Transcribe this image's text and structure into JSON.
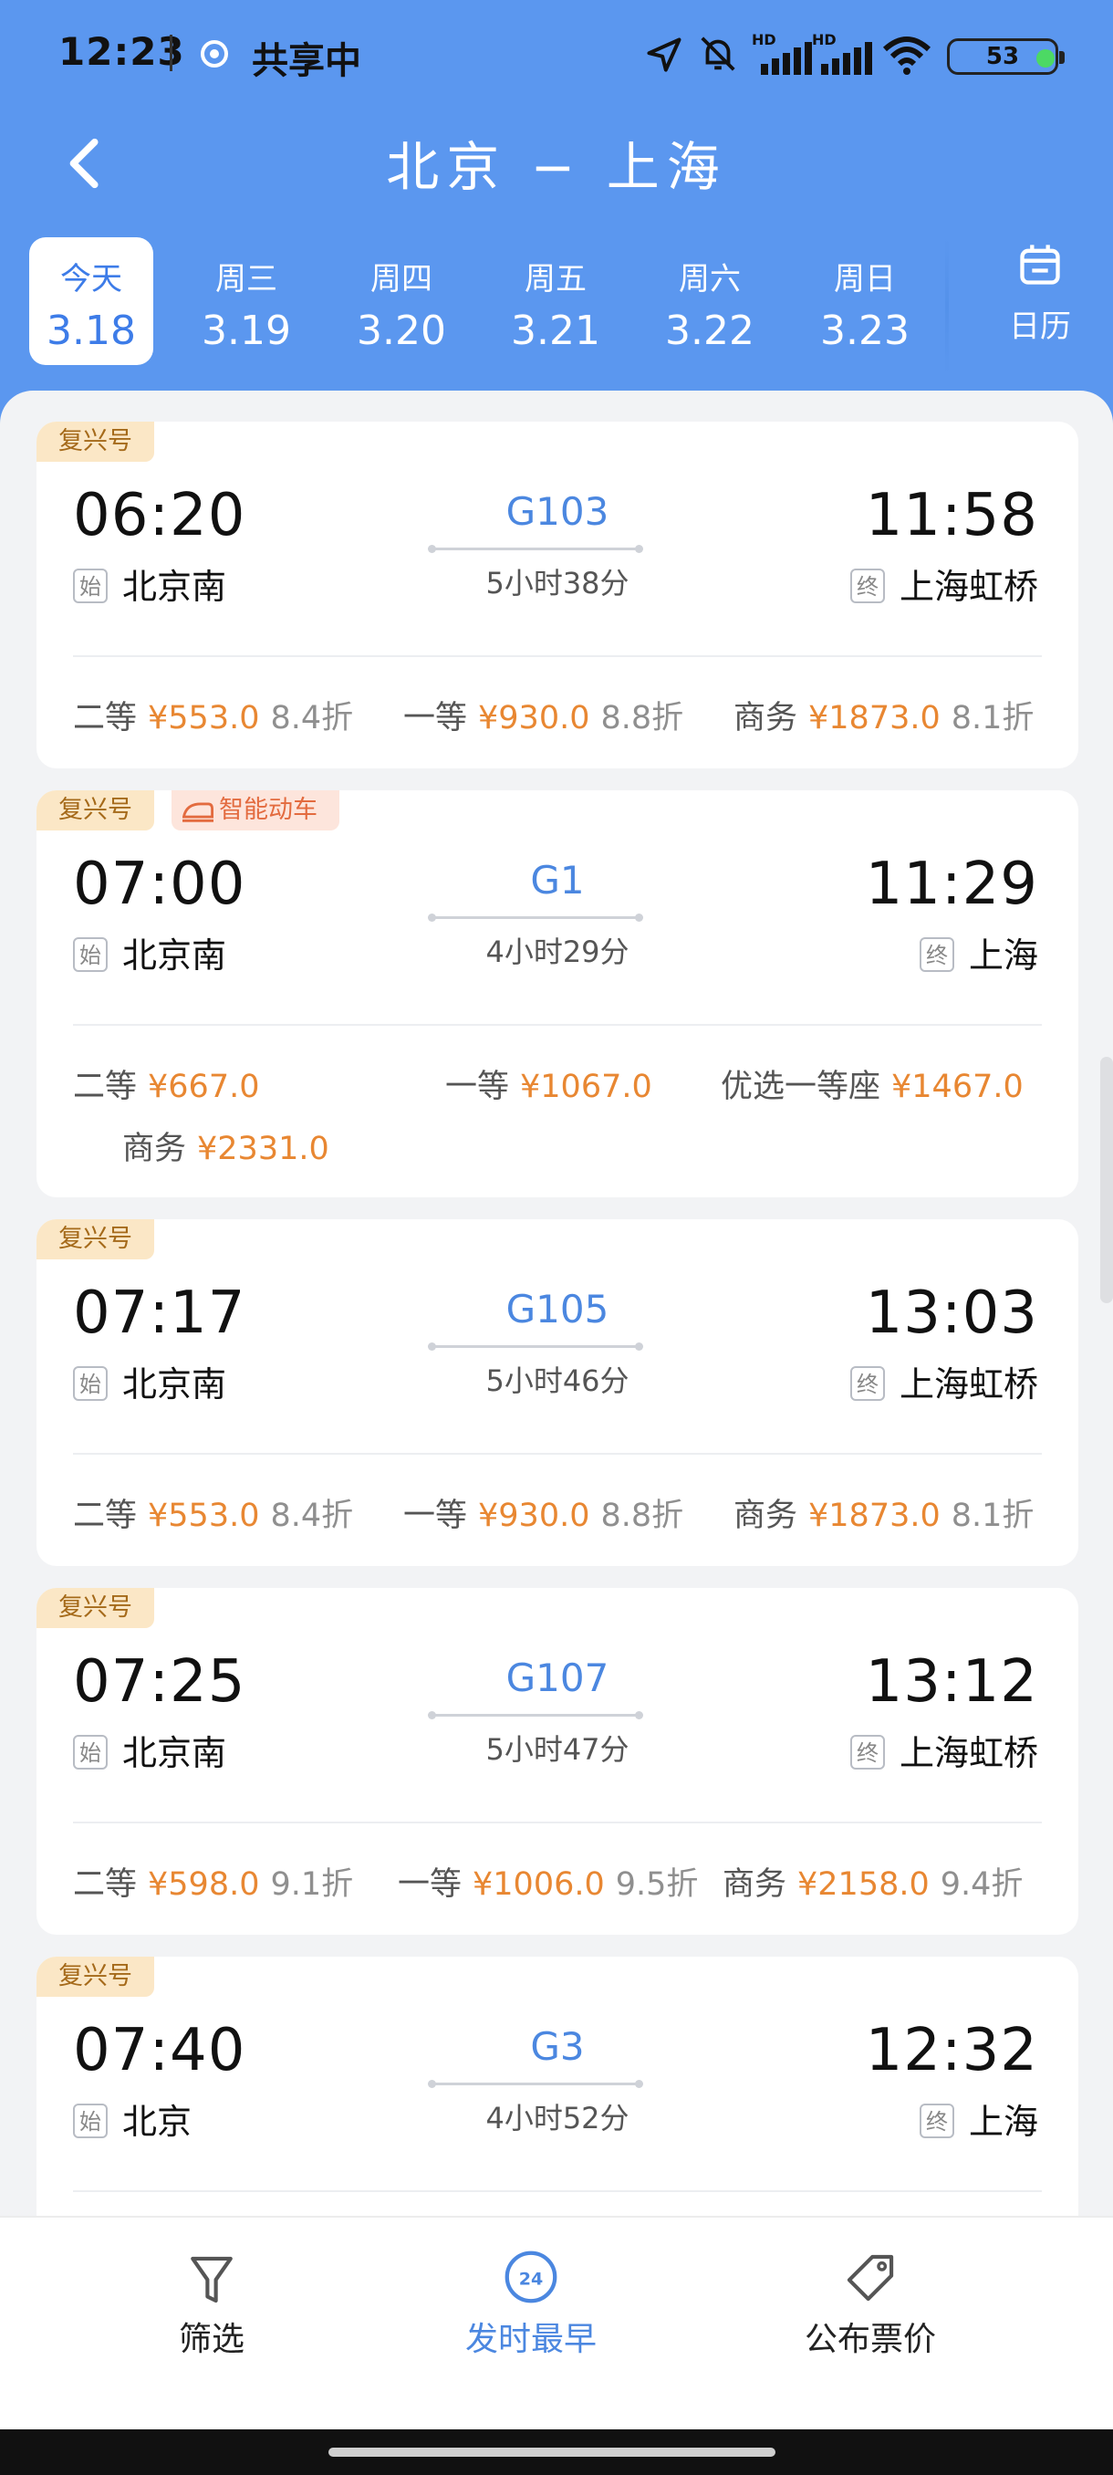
{
  "status_bar": {
    "time": "12:23",
    "sharing_label": "共享中",
    "battery": "53",
    "signal_label_1": "HD",
    "signal_label_2": "HD"
  },
  "nav": {
    "title": "北京 − 上海"
  },
  "dates": [
    {
      "dow": "今天",
      "date": "3.18",
      "active": true
    },
    {
      "dow": "周三",
      "date": "3.19"
    },
    {
      "dow": "周四",
      "date": "3.20"
    },
    {
      "dow": "周五",
      "date": "3.21"
    },
    {
      "dow": "周六",
      "date": "3.22"
    },
    {
      "dow": "周日",
      "date": "3.23"
    }
  ],
  "calendar_label": "日历",
  "badges": {
    "start": "始",
    "end": "终"
  },
  "trains": [
    {
      "tag": "复兴号",
      "dep_time": "06:20",
      "arr_time": "11:58",
      "train_no": "G103",
      "duration": "5小时38分",
      "from": "北京南",
      "to": "上海虹桥",
      "seats": [
        {
          "class": "二等",
          "price": "¥553.0",
          "disc": "8.4折"
        },
        {
          "class": "一等",
          "price": "¥930.0",
          "disc": "8.8折"
        },
        {
          "class": "商务",
          "price": "¥1873.0",
          "disc": "8.1折"
        }
      ]
    },
    {
      "tag": "复兴号",
      "tag2": "智能动车",
      "dep_time": "07:00",
      "arr_time": "11:29",
      "train_no": "G1",
      "duration": "4小时29分",
      "from": "北京南",
      "to": "上海",
      "seats": [
        {
          "class": "二等",
          "price": "¥667.0",
          "disc": ""
        },
        {
          "class": "一等",
          "price": "¥1067.0",
          "disc": ""
        },
        {
          "class": "优选一等座",
          "price": "¥1467.0",
          "disc": ""
        },
        {
          "class": "商务",
          "price": "¥2331.0",
          "disc": ""
        }
      ]
    },
    {
      "tag": "复兴号",
      "dep_time": "07:17",
      "arr_time": "13:03",
      "train_no": "G105",
      "duration": "5小时46分",
      "from": "北京南",
      "to": "上海虹桥",
      "seats": [
        {
          "class": "二等",
          "price": "¥553.0",
          "disc": "8.4折"
        },
        {
          "class": "一等",
          "price": "¥930.0",
          "disc": "8.8折"
        },
        {
          "class": "商务",
          "price": "¥1873.0",
          "disc": "8.1折"
        }
      ]
    },
    {
      "tag": "复兴号",
      "dep_time": "07:25",
      "arr_time": "13:12",
      "train_no": "G107",
      "duration": "5小时47分",
      "from": "北京南",
      "to": "上海虹桥",
      "seats": [
        {
          "class": "二等",
          "price": "¥598.0",
          "disc": "9.1折"
        },
        {
          "class": "一等",
          "price": "¥1006.0",
          "disc": "9.5折"
        },
        {
          "class": "商务",
          "price": "¥2158.0",
          "disc": "9.4折"
        }
      ]
    },
    {
      "tag": "复兴号",
      "dep_time": "07:40",
      "arr_time": "12:32",
      "train_no": "G3",
      "duration": "4小时52分",
      "from": "北京",
      "to": "上海",
      "seats": []
    }
  ],
  "bottom_bar": {
    "filter": "筛选",
    "earliest": "发时最早",
    "earliest_badge": "24",
    "price": "公布票价"
  },
  "colors": {
    "header_blue": "#5b97ef",
    "price_orange": "#e88732",
    "train_blue": "#4b87e0"
  }
}
